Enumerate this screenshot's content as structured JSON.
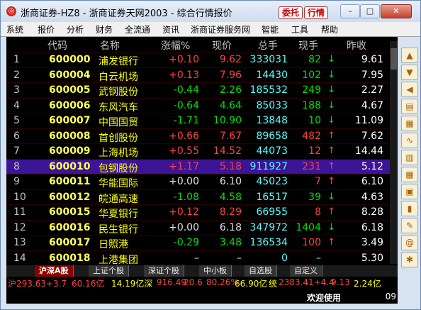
{
  "window": {
    "title": "浙商证券-HZ8 - 浙商证券天网2003 - 综合行情报价",
    "entrust_btn": "委托",
    "quote_btn": "行情",
    "min": "–",
    "max": "□",
    "close": "✕"
  },
  "menu": [
    "系统",
    "报价",
    "分析",
    "财务",
    "全流通",
    "资讯",
    "浙商证券服务网",
    "智能",
    "工具",
    "帮助"
  ],
  "columns": [
    "代码",
    "名称",
    "涨幅%",
    "现价",
    "总手",
    "现手",
    "昨收"
  ],
  "rows": [
    {
      "no": "1",
      "code": "600000",
      "name": "浦发银行",
      "chg": "+0.10",
      "price": "9.62",
      "vol": "333031",
      "now": "82",
      "dir": "down",
      "prev": "9.61"
    },
    {
      "no": "2",
      "code": "600004",
      "name": "白云机场",
      "chg": "+0.13",
      "price": "7.96",
      "vol": "14430",
      "now": "102",
      "dir": "down",
      "prev": "7.95"
    },
    {
      "no": "3",
      "code": "600005",
      "name": "武钢股份",
      "chg": "-0.44",
      "price": "2.26",
      "vol": "185532",
      "now": "249",
      "dir": "down",
      "prev": "2.27"
    },
    {
      "no": "4",
      "code": "600006",
      "name": "东风汽车",
      "chg": "-0.64",
      "price": "4.64",
      "vol": "85033",
      "now": "188",
      "dir": "down",
      "prev": "4.67"
    },
    {
      "no": "5",
      "code": "600007",
      "name": "中国国贸",
      "chg": "-1.71",
      "price": "10.90",
      "vol": "13848",
      "now": "10",
      "dir": "down",
      "prev": "11.09"
    },
    {
      "no": "6",
      "code": "600008",
      "name": "首创股份",
      "chg": "+0.66",
      "price": "7.67",
      "vol": "89658",
      "now": "482",
      "dir": "up",
      "prev": "7.62"
    },
    {
      "no": "7",
      "code": "600009",
      "name": "上海机场",
      "chg": "+0.55",
      "price": "14.52",
      "vol": "44073",
      "now": "12",
      "dir": "up",
      "prev": "14.44"
    },
    {
      "no": "8",
      "code": "600010",
      "name": "包钢股份",
      "chg": "+1.17",
      "price": "5.18",
      "vol": "911927",
      "now": "231",
      "dir": "up",
      "prev": "5.12"
    },
    {
      "no": "9",
      "code": "600011",
      "name": "华能国际",
      "chg": "+0.00",
      "price": "6.10",
      "vol": "45023",
      "now": "7",
      "dir": "up",
      "prev": "6.10"
    },
    {
      "no": "10",
      "code": "600012",
      "name": "皖通高速",
      "chg": "-1.08",
      "price": "4.58",
      "vol": "16517",
      "now": "39",
      "dir": "down",
      "prev": "4.63"
    },
    {
      "no": "11",
      "code": "600015",
      "name": "华夏银行",
      "chg": "+0.12",
      "price": "8.29",
      "vol": "66955",
      "now": "8",
      "dir": "up",
      "prev": "8.28"
    },
    {
      "no": "12",
      "code": "600016",
      "name": "民生银行",
      "chg": "+0.00",
      "price": "6.18",
      "vol": "347972",
      "now": "1404",
      "dir": "down",
      "prev": "6.18"
    },
    {
      "no": "13",
      "code": "600017",
      "name": "日照港",
      "chg": "-0.29",
      "price": "3.48",
      "vol": "136534",
      "now": "100",
      "dir": "up",
      "prev": "3.49"
    },
    {
      "no": "14",
      "code": "600018",
      "name": "上港集团",
      "chg": "–",
      "price": "–",
      "vol": "0",
      "now": "–",
      "dir": "none",
      "prev": "5.30"
    }
  ],
  "tabs": [
    "沪深A股",
    "上证个股",
    "深证个股",
    "中小板",
    "自选股",
    "自定义"
  ],
  "ticker": {
    "sh": "沪293.63+3.7",
    "shv": "60.16亿",
    "szname": "14.19亿深",
    "sz": "916.49",
    "szc": "20.6",
    "sz2": "80.26%",
    "sz3": "66.90亿",
    "tong": "统",
    "tv": "2383.41+4.4",
    "tv2": "9.13",
    "tv3": "2.24亿"
  },
  "status": {
    "welcome": "欢迎使用",
    "clock": "09"
  },
  "colors": {
    "up": "#ff4040",
    "down": "#00e000",
    "selected": "#3c1496"
  }
}
